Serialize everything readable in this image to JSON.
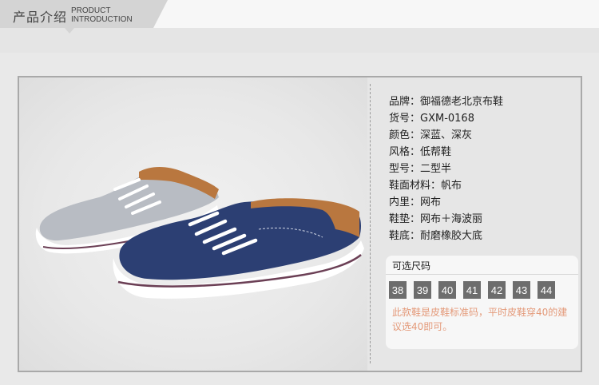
{
  "header": {
    "title_cn": "产品介绍",
    "title_en_line1": "PRODUCT",
    "title_en_line2": "INTRODUCTION"
  },
  "specs": [
    "品牌：御福德老北京布鞋",
    "货号：GXM-0168",
    "颜色：深蓝、深灰",
    "风格：低帮鞋",
    "型号：二型半",
    "鞋面材料：帆布",
    "内里：网布",
    "鞋垫：网布＋海波丽",
    "鞋底：耐磨橡胶大底"
  ],
  "sizes": {
    "title": "可选尺码",
    "options": [
      "38",
      "39",
      "40",
      "41",
      "42",
      "43",
      "44"
    ],
    "note": "此款鞋是皮鞋标准码，平时皮鞋穿40的建议选40即可。"
  },
  "colors": {
    "navy": "#2c3f73",
    "grey": "#b8bcc3",
    "tan": "#b9773f",
    "note_text": "#e49a7a",
    "chip": "#6d6d6d"
  }
}
